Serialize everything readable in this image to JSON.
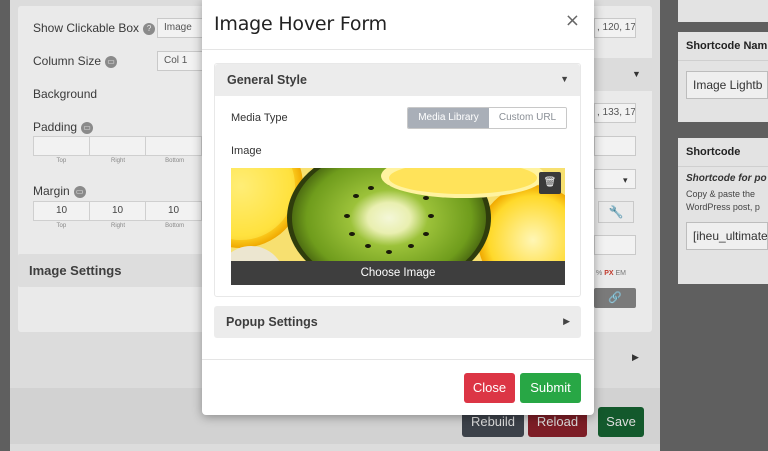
{
  "background": {
    "left_panel": {
      "show_clickable_box_label": "Show Clickable Box",
      "show_clickable_box_value": "Image",
      "column_size_label": "Column Size",
      "column_size_value": "Col 1",
      "background_label": "Background",
      "padding_label": "Padding",
      "padding_caps": [
        "Top",
        "Right",
        "Bottom"
      ],
      "margin_label": "Margin",
      "margin_values": [
        "10",
        "10",
        "10"
      ],
      "margin_caps": [
        "Top",
        "Right",
        "Bottom"
      ],
      "image_settings_label": "Image Settings"
    },
    "right_fields": {
      "value_top": ", 120, 17",
      "value_mid": ", 133, 17",
      "units_percent": "%",
      "units_px": "PX",
      "units_em": "EM"
    },
    "buttons": {
      "rebuild": "Rebuild",
      "reload": "Reload",
      "save": "Save"
    },
    "sidebar": {
      "shortcode_name_title": "Shortcode Nam",
      "shortcode_name_value": "Image Lightb",
      "shortcode_title": "Shortcode",
      "shortcode_note_bold": "Shortcode for po",
      "shortcode_note_line1": "Copy & paste the",
      "shortcode_note_line2": "WordPress post, p",
      "shortcode_value": "[iheu_ultimate"
    }
  },
  "modal": {
    "title": "Image Hover Form",
    "close_glyph": "×",
    "general_style": {
      "title": "General Style",
      "caret": "▼",
      "media_type_label": "Media Type",
      "media_options": [
        "Media Library",
        "Custom URL"
      ],
      "selected_media": "Media Library",
      "image_label": "Image",
      "choose_image_label": "Choose Image",
      "delete_icon": "trash-icon"
    },
    "popup_settings": {
      "title": "Popup Settings",
      "caret": "▶"
    },
    "footer": {
      "close_label": "Close",
      "submit_label": "Submit"
    }
  },
  "colors": {
    "close_button": "#dc3545",
    "submit_button": "#28a745",
    "segment_active": "#a9afb8",
    "overlay": "#5f5f5f"
  }
}
